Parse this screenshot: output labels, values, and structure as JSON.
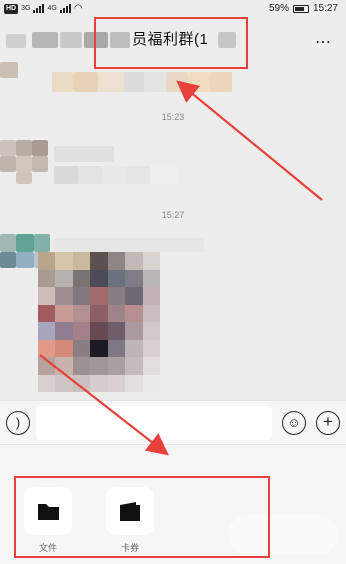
{
  "status_bar": {
    "network_badge": "HD",
    "signal_label_1": "3G",
    "signal_label_2": "4G",
    "battery_percent": "59%",
    "time": "15:27"
  },
  "header": {
    "title_visible": "员福利群(1",
    "more_icon": "⋯"
  },
  "chat": {
    "timestamps": [
      "15:23",
      "15:27"
    ]
  },
  "input_bar": {
    "voice_icon": "voice-icon",
    "emoji_icon": "emoji-icon",
    "plus_icon": "plus-icon"
  },
  "more_panel": {
    "tools": [
      {
        "label": "文件",
        "icon": "folder-icon"
      },
      {
        "label": "卡券",
        "icon": "card-icon"
      }
    ]
  },
  "annotation_color": "#e8403a"
}
